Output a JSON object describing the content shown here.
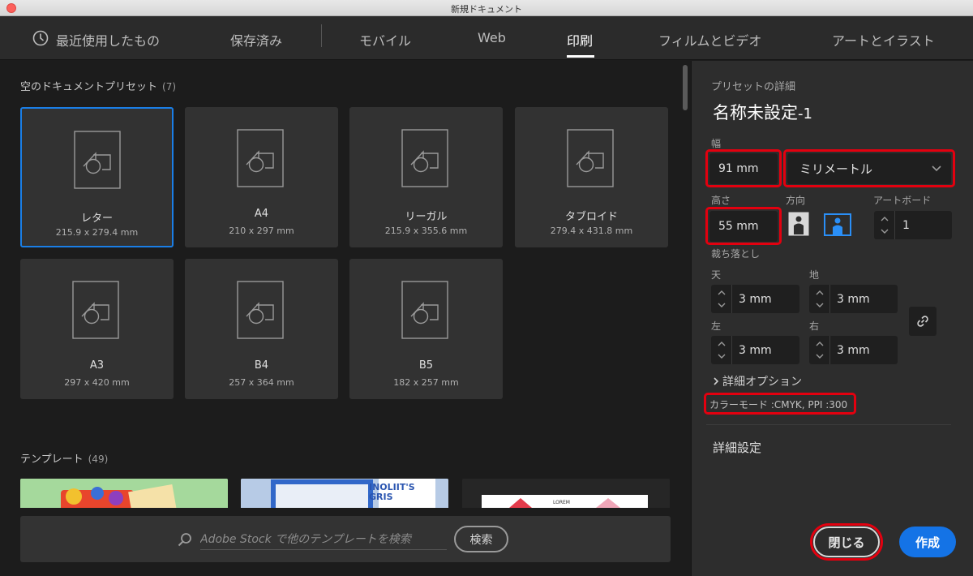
{
  "window": {
    "title": "新規ドキュメント"
  },
  "tabs": [
    {
      "label": "最近使用したもの",
      "icon": "clock-icon"
    },
    {
      "label": "保存済み"
    },
    {
      "label": "モバイル"
    },
    {
      "label": "Web"
    },
    {
      "label": "印刷",
      "active": true
    },
    {
      "label": "フィルムとビデオ"
    },
    {
      "label": "アートとイラスト"
    }
  ],
  "presets": {
    "title": "空のドキュメントプリセット",
    "count": "(7)",
    "items": [
      {
        "name": "レター",
        "size": "215.9 x 279.4 mm",
        "selected": true
      },
      {
        "name": "A4",
        "size": "210 x 297 mm"
      },
      {
        "name": "リーガル",
        "size": "215.9 x 355.6 mm"
      },
      {
        "name": "タブロイド",
        "size": "279.4 x 431.8 mm"
      },
      {
        "name": "A3",
        "size": "297 x 420 mm"
      },
      {
        "name": "B4",
        "size": "257 x 364 mm"
      },
      {
        "name": "B5",
        "size": "182 x 257 mm"
      }
    ]
  },
  "templates": {
    "title": "テンプレート",
    "count": "(49)",
    "thumb2_text": "INOLIIT'S GRIS",
    "thumb3_text": "LOREM"
  },
  "search": {
    "placeholder": "Adobe Stock で他のテンプレートを検索",
    "button": "検索"
  },
  "details": {
    "header": "プリセットの詳細",
    "name": "名称未設定",
    "name_suffix": "-1",
    "width_label": "幅",
    "width_value": "91 mm",
    "unit_value": "ミリメートル",
    "height_label": "高さ",
    "height_value": "55 mm",
    "orientation_label": "方向",
    "artboard_label": "アートボード",
    "artboard_value": "1",
    "bleed_label": "裁ち落とし",
    "bleed_top_label": "天",
    "bleed_top_value": "3 mm",
    "bleed_bottom_label": "地",
    "bleed_bottom_value": "3 mm",
    "bleed_left_label": "左",
    "bleed_left_value": "3 mm",
    "bleed_right_label": "右",
    "bleed_right_value": "3 mm",
    "advanced_options": "詳細オプション",
    "color_mode": "カラーモード :CMYK, PPI :300",
    "advanced_settings": "詳細設定",
    "close_button": "閉じる",
    "create_button": "作成"
  },
  "colors": {
    "accent": "#1473e6",
    "selection": "#1a7ee6",
    "highlight": "#e3000f",
    "panel": "#2d2d2d",
    "background": "#1c1c1c"
  }
}
